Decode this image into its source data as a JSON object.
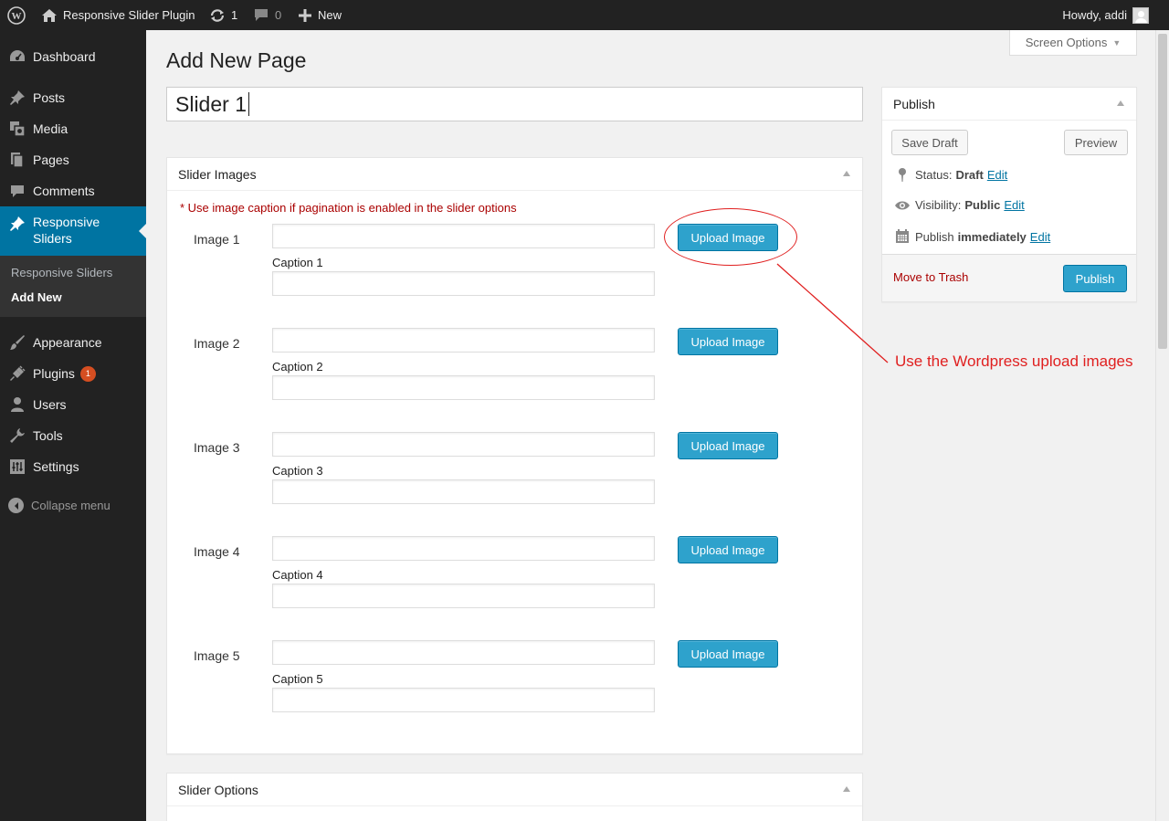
{
  "admin_bar": {
    "site_name": "Responsive Slider Plugin",
    "updates_count": "1",
    "comments_count": "0",
    "new_label": "New",
    "howdy": "Howdy, addi"
  },
  "sidebar": {
    "items": [
      {
        "label": "Dashboard",
        "icon": "dashboard-icon"
      },
      {
        "label": "Posts",
        "icon": "pin-icon"
      },
      {
        "label": "Media",
        "icon": "media-icon"
      },
      {
        "label": "Pages",
        "icon": "pages-icon"
      },
      {
        "label": "Comments",
        "icon": "comment-icon"
      },
      {
        "label": "Responsive Sliders",
        "icon": "pin-icon"
      },
      {
        "label": "Appearance",
        "icon": "brush-icon"
      },
      {
        "label": "Plugins",
        "icon": "plug-icon",
        "badge": "1"
      },
      {
        "label": "Users",
        "icon": "user-icon"
      },
      {
        "label": "Tools",
        "icon": "wrench-icon"
      },
      {
        "label": "Settings",
        "icon": "settings-icon"
      }
    ],
    "sliders_label_line1": "Responsive",
    "sliders_label_line2": "Sliders",
    "submenu": [
      "Responsive Sliders",
      "Add New"
    ],
    "collapse": "Collapse menu"
  },
  "page": {
    "title": "Add New Page",
    "screen_options": "Screen Options",
    "post_title": "Slider 1"
  },
  "slider_images": {
    "heading": "Slider Images",
    "note": "* Use image caption if pagination is enabled in the slider options",
    "upload_label": "Upload Image",
    "rows": [
      {
        "image_label": "Image 1",
        "caption_label": "Caption 1"
      },
      {
        "image_label": "Image 2",
        "caption_label": "Caption 2"
      },
      {
        "image_label": "Image 3",
        "caption_label": "Caption 3"
      },
      {
        "image_label": "Image 4",
        "caption_label": "Caption 4"
      },
      {
        "image_label": "Image 5",
        "caption_label": "Caption 5"
      }
    ]
  },
  "slider_options": {
    "heading": "Slider Options"
  },
  "publish": {
    "heading": "Publish",
    "save_draft": "Save Draft",
    "preview": "Preview",
    "status_label": "Status:",
    "status_value": "Draft",
    "visibility_label": "Visibility:",
    "visibility_value": "Public",
    "schedule_label": "Publish",
    "schedule_value": "immediately",
    "edit": "Edit",
    "trash": "Move to Trash",
    "publish_button": "Publish"
  },
  "annotation": {
    "text": "Use the Wordpress upload images",
    "color": "#e02020"
  },
  "colors": {
    "admin_bar": "#222222",
    "sidebar_active": "#0074a2",
    "primary_button": "#2ea2cc",
    "trash_link": "#aa0000"
  }
}
